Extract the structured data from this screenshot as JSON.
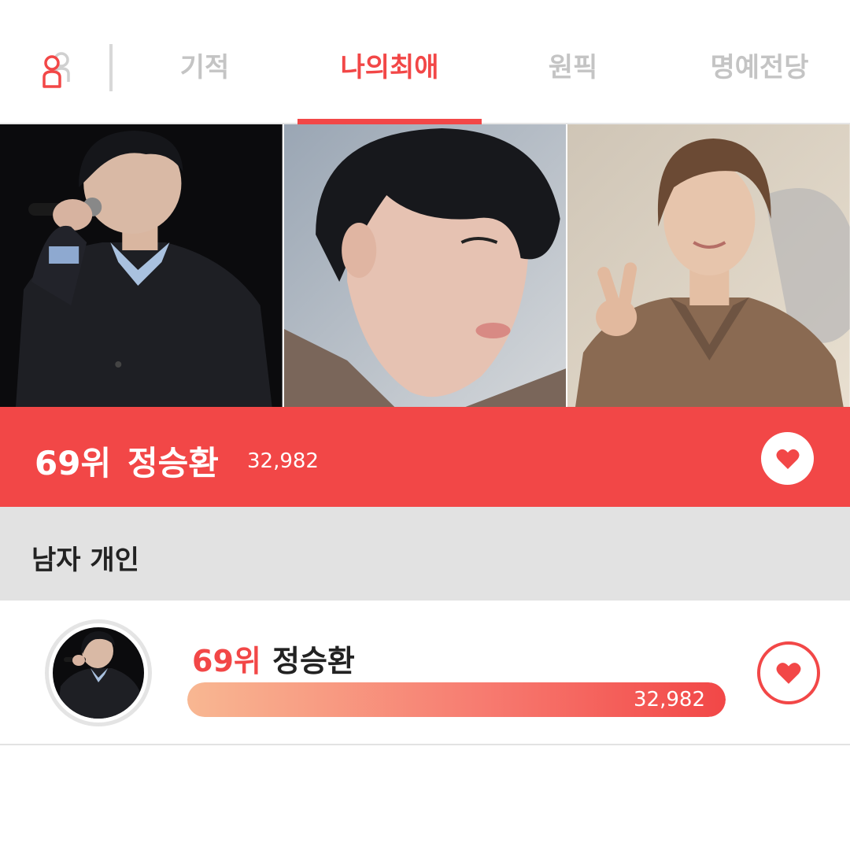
{
  "tabs": [
    {
      "label": "기적",
      "active": false
    },
    {
      "label": "나의최애",
      "active": true
    },
    {
      "label": "원픽",
      "active": false
    },
    {
      "label": "명예전당",
      "active": false
    }
  ],
  "icons": {
    "user": "user-icon",
    "heart": "heart-icon"
  },
  "banner": {
    "rank": "69위",
    "name": "정승환",
    "votes": "32,982"
  },
  "category": {
    "label": "남자 개인"
  },
  "ranking_row": {
    "rank": "69위",
    "name": "정승환",
    "votes": "32,982",
    "progress_fraction": 1.0
  },
  "colors": {
    "accent": "#f24747",
    "tab_inactive": "#c4c4c4",
    "category_bg": "#e2e2e2",
    "bar_gradient_start": "#f8b792",
    "bar_gradient_end": "#f24747"
  }
}
